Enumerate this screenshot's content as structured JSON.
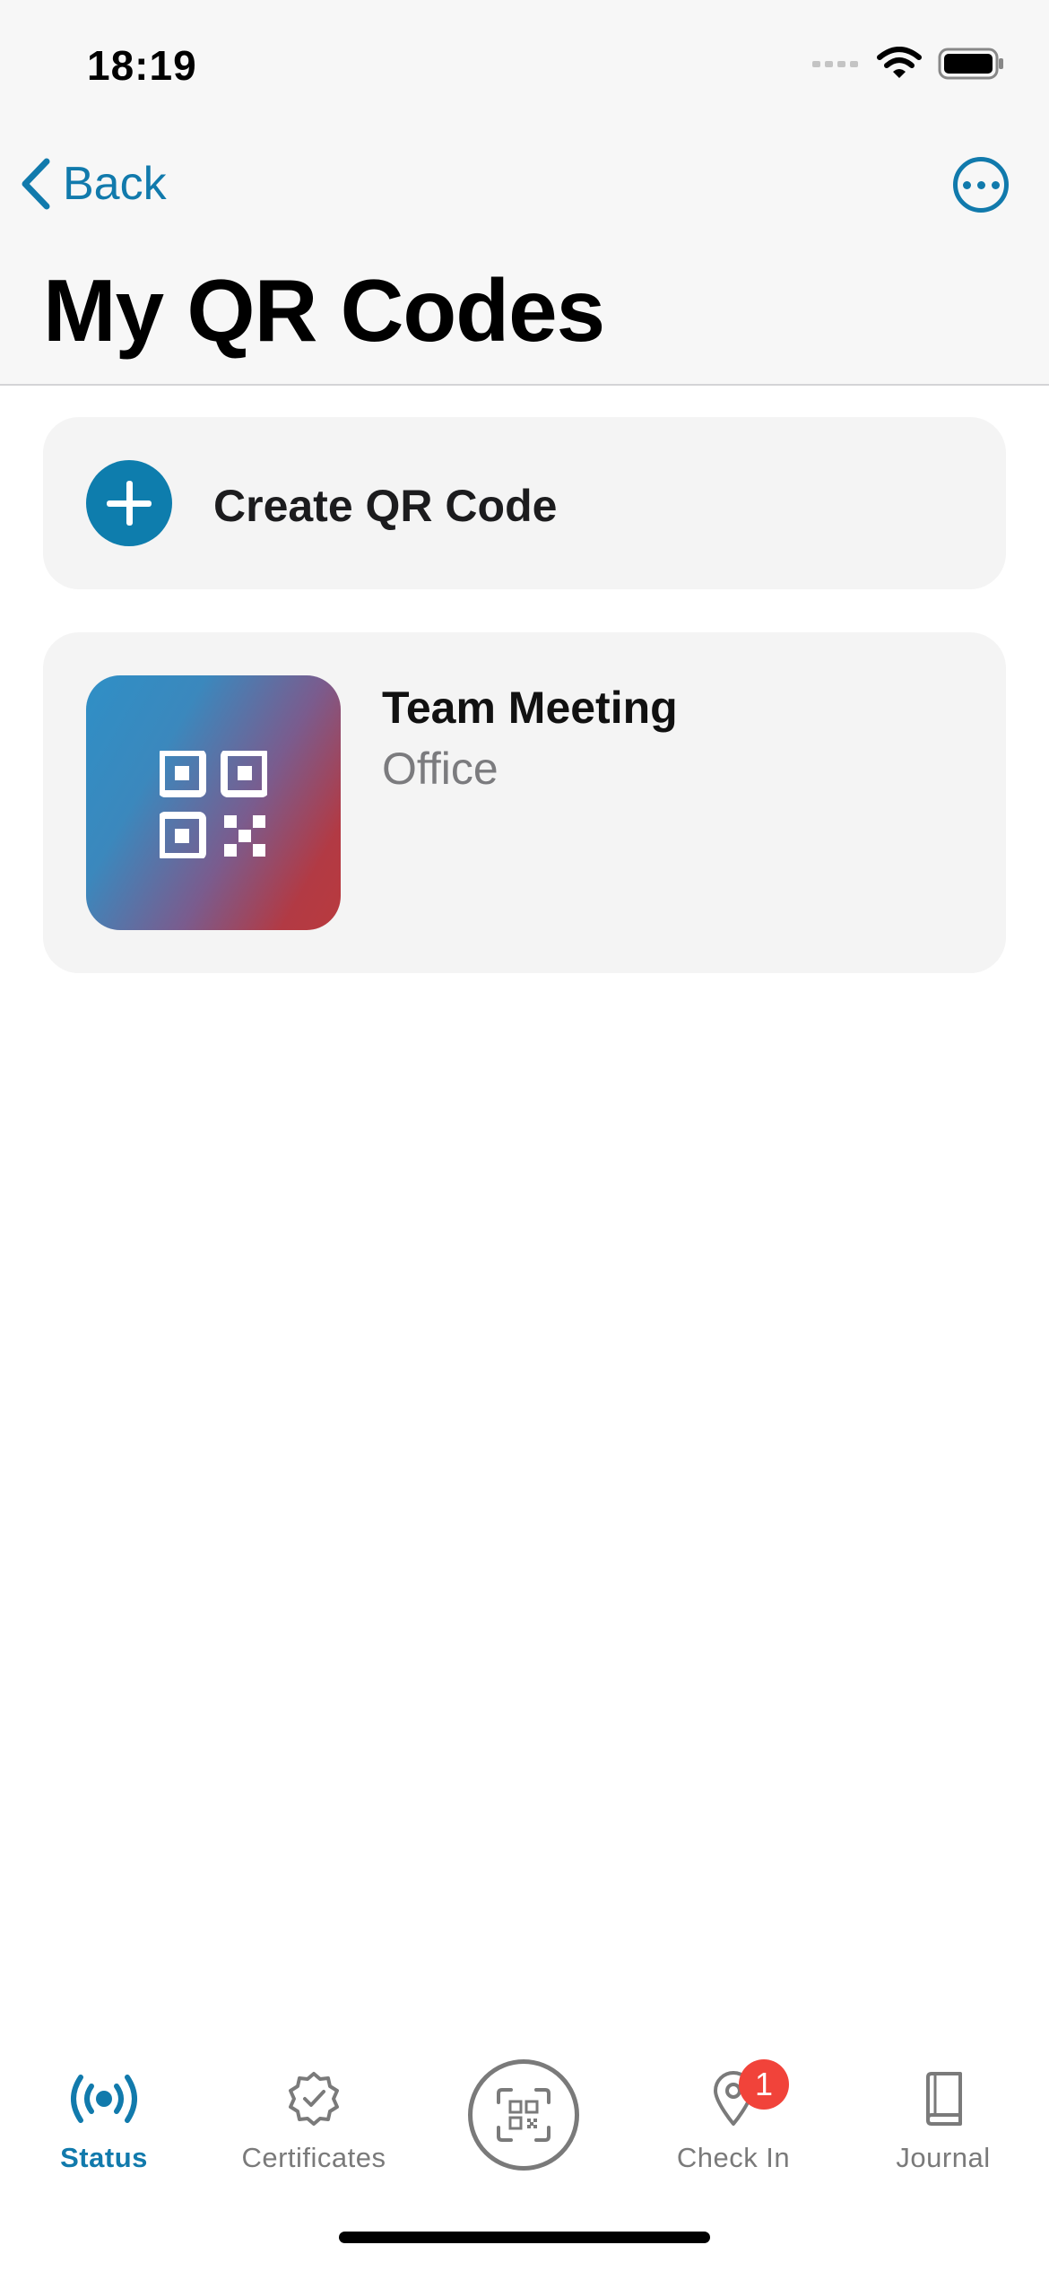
{
  "status_bar": {
    "time": "18:19"
  },
  "nav": {
    "back_label": "Back",
    "title": "My QR Codes"
  },
  "create_card": {
    "label": "Create QR Code"
  },
  "qr_codes": [
    {
      "title": "Team Meeting",
      "subtitle": "Office"
    }
  ],
  "tabbar": {
    "tabs": [
      {
        "label": "Status",
        "icon": "broadcast-icon",
        "active": true
      },
      {
        "label": "Certificates",
        "icon": "certificate-check-icon",
        "active": false
      },
      {
        "label": "",
        "icon": "qr-scan-icon",
        "active": false
      },
      {
        "label": "Check In",
        "icon": "map-pin-icon",
        "active": false,
        "badge": "1"
      },
      {
        "label": "Journal",
        "icon": "book-icon",
        "active": false
      }
    ]
  },
  "colors": {
    "accent": "#117aac",
    "badge": "#f1433a",
    "card_bg": "#f4f4f4",
    "inactive": "#7a7a7a"
  }
}
